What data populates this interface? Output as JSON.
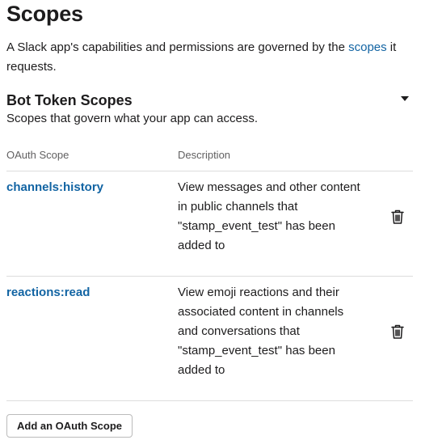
{
  "page": {
    "title": "Scopes",
    "intro_prefix": "A Slack app's capabilities and permissions are governed by the ",
    "intro_link": "scopes",
    "intro_suffix": " it requests."
  },
  "bot_token_scopes": {
    "title": "Bot Token Scopes",
    "description": "Scopes that govern what your app can access.",
    "columns": {
      "scope": "OAuth Scope",
      "description": "Description"
    },
    "rows": [
      {
        "scope": "channels:history",
        "description": "View messages and other content in public channels that \"stamp_event_test\" has been added to"
      },
      {
        "scope": "reactions:read",
        "description": "View emoji reactions and their associated content in channels and conversations that \"stamp_event_test\" has been added to"
      }
    ],
    "add_button_label": "Add an OAuth Scope"
  },
  "icons": {
    "collapse": "caret-down-icon",
    "remove": "trash-icon"
  },
  "colors": {
    "link": "#1264a3",
    "text": "#1d1c1d",
    "muted": "#616061",
    "divider": "#dddddd"
  }
}
